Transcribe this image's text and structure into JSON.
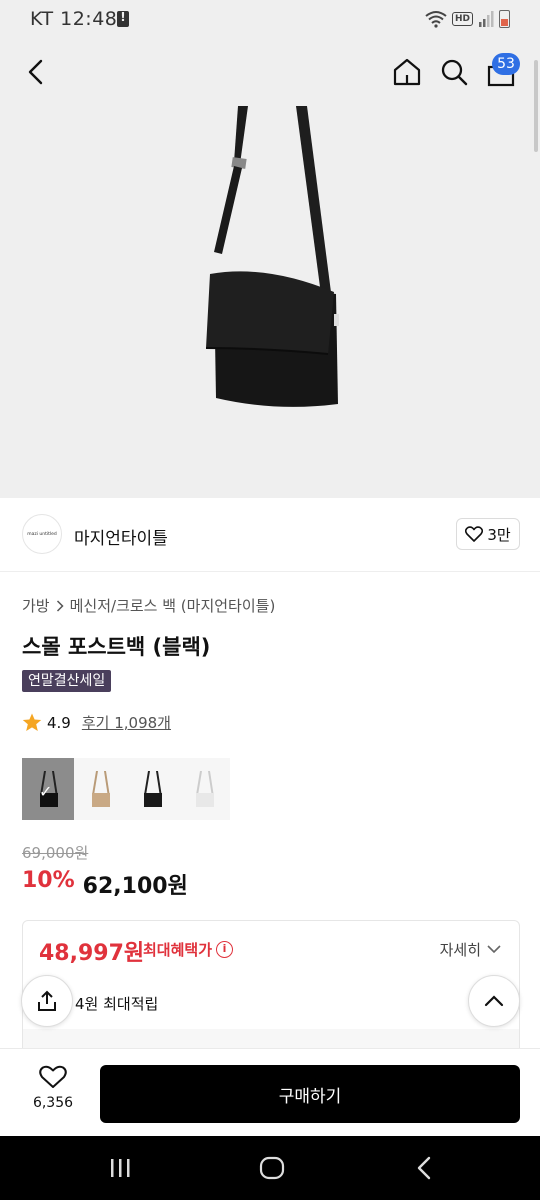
{
  "status_bar": {
    "carrier_time": "KT 12:48",
    "hd_label": "HD"
  },
  "header": {
    "cart_count": "53"
  },
  "brand": {
    "logo_text": "mazi untitled",
    "name": "마지언타이틀",
    "like_count": "3만"
  },
  "breadcrumb": {
    "category": "가방",
    "subcategory": "메신저/크로스 백 (마지언타이틀)"
  },
  "product": {
    "title": "스몰 포스트백 (블랙)",
    "sale_tag": "연말결산세일",
    "rating": "4.9",
    "reviews": "후기 1,098개",
    "original_price": "69,000원",
    "discount": "10%",
    "price": "62,100원"
  },
  "color_options": [
    {
      "name": "black",
      "selected": true
    },
    {
      "name": "beige",
      "selected": false
    },
    {
      "name": "black-alt",
      "selected": false
    },
    {
      "name": "white",
      "selected": false
    }
  ],
  "benefit": {
    "max_price": "48,997원",
    "max_label": "최대혜택가",
    "detail_label": "자세히",
    "points": "4원 최대적립"
  },
  "bottom_bar": {
    "wish_count": "6,356",
    "buy_label": "구매하기"
  },
  "colors": {
    "accent_red": "#e0323c",
    "badge_blue": "#2f6fe4",
    "sale_tag_bg": "#4a3f5c"
  }
}
